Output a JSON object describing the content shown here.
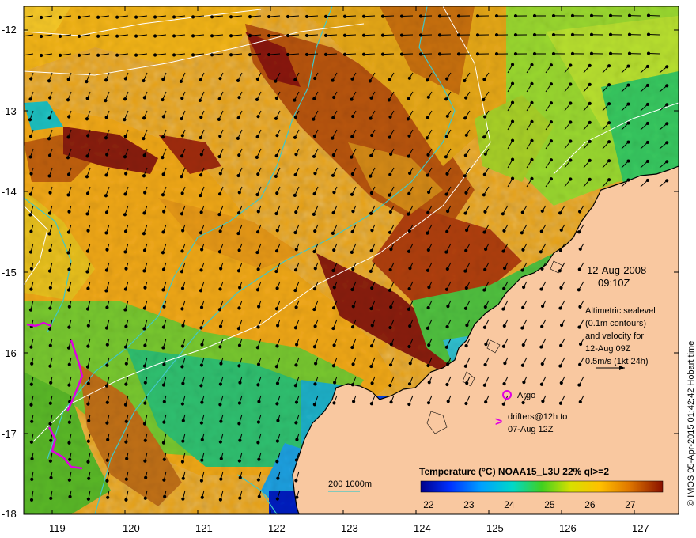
{
  "map": {
    "lat_labels": [
      "-12",
      "-13",
      "-14",
      "-15",
      "-16",
      "-17",
      "-18"
    ],
    "lon_labels": [
      "119",
      "120",
      "121",
      "122",
      "123",
      "124",
      "125",
      "126",
      "127"
    ],
    "date_line1": "12-Aug-2008",
    "date_line2": "09:10Z",
    "info_lines": [
      "Altimetric sealevel",
      "(0.1m contours)",
      "and velocity for",
      "12-Aug 09Z",
      "0.5m/s (1kt 24h)"
    ],
    "argo_label": "Argo",
    "drifters_line1": "drifters@12h to",
    "drifters_line2": "07-Aug 12Z",
    "bathy_label": "200  1000m",
    "credit": "© IMOS 05-Apr-2015 01:42:42 Hobart time",
    "colors": {
      "land": "#f9c8a0",
      "sea_base": "#e69a10",
      "contour": "#ffffff",
      "bathy": "#40c8c8",
      "argo": "#e000e0"
    }
  },
  "colorbar": {
    "title": "Temperature (°C) NOAA15_L3U 22% ql>=2",
    "ticks": [
      "22",
      "23",
      "24",
      "25",
      "26",
      "27"
    ],
    "range": [
      21.8,
      27.8
    ]
  }
}
